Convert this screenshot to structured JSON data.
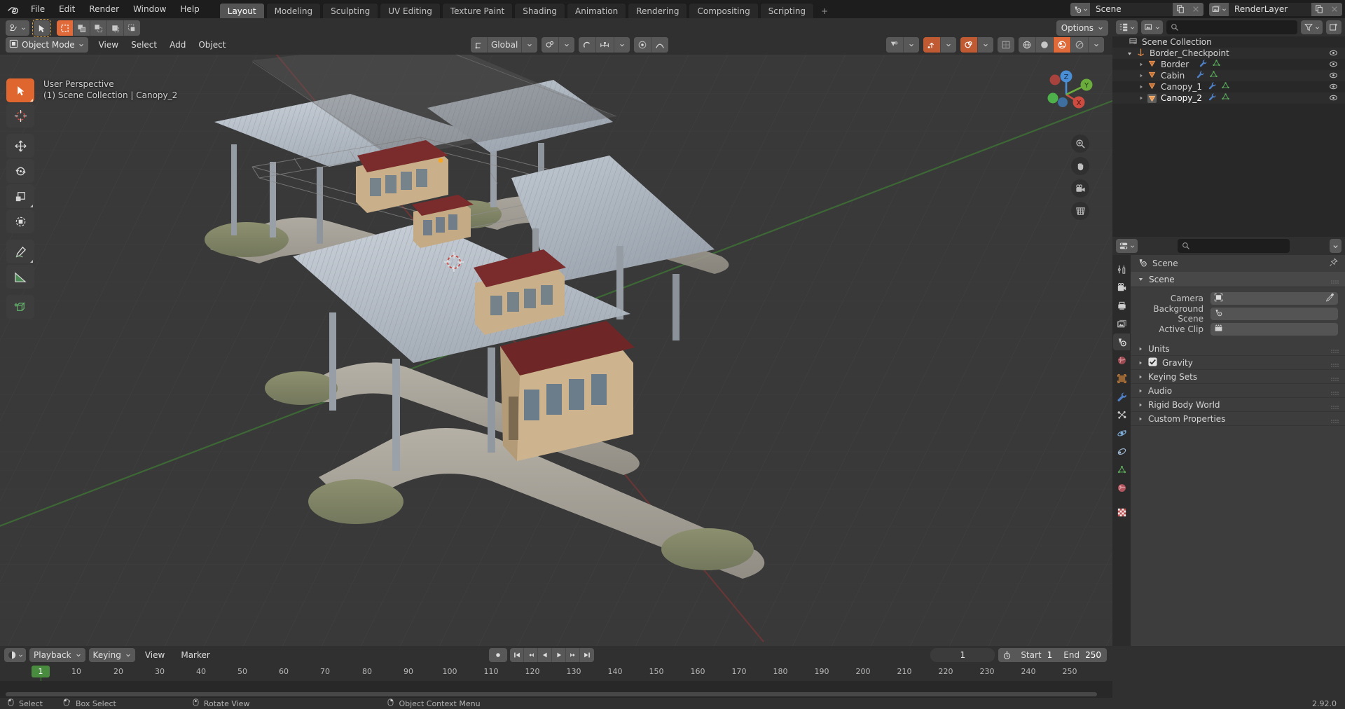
{
  "app": {
    "version": "2.92.0",
    "logo_icon": "blender-logo-icon"
  },
  "topbar": {
    "menus": [
      "File",
      "Edit",
      "Render",
      "Window",
      "Help"
    ],
    "workspaces": [
      {
        "label": "Layout",
        "active": true
      },
      {
        "label": "Modeling",
        "active": false
      },
      {
        "label": "Sculpting",
        "active": false
      },
      {
        "label": "UV Editing",
        "active": false
      },
      {
        "label": "Texture Paint",
        "active": false
      },
      {
        "label": "Shading",
        "active": false
      },
      {
        "label": "Animation",
        "active": false
      },
      {
        "label": "Rendering",
        "active": false
      },
      {
        "label": "Compositing",
        "active": false
      },
      {
        "label": "Scripting",
        "active": false
      }
    ],
    "add_workspace_label": "+",
    "scene": {
      "icon": "scene-icon",
      "value": "Scene",
      "new_icon": "duplicate-icon",
      "unlink_icon": "x-icon"
    },
    "view_layer": {
      "icon": "view-layer-icon",
      "value": "RenderLayer",
      "new_icon": "duplicate-icon",
      "unlink_icon": "x-icon"
    }
  },
  "viewport": {
    "editor_type_icon": "editor-type-3dview-icon",
    "mode": "Object Mode",
    "mode_icon": "object-mode-icon",
    "menus": [
      "View",
      "Select",
      "Add",
      "Object"
    ],
    "select_modes": [
      "select-box-icon",
      "select-extend-icon",
      "select-subtract-icon",
      "select-invert-icon",
      "select-intersect-icon"
    ],
    "cursor_icon": "select-tweak-icon",
    "transform_orientation": {
      "label": "Global",
      "icon": "orientation-icon"
    },
    "snap_icon": "snap-magnet-icon",
    "proportional_icon": "proportional-edit-icon",
    "proportional_falloff_icon": "falloff-smooth-icon",
    "options_label": "Options",
    "overlay_toggles": [
      "visibility-icon",
      "gizmo-icon",
      "overlays-icon",
      "xray-icon"
    ],
    "shading_modes": [
      "wireframe-icon",
      "solid-icon",
      "material-preview-icon",
      "rendered-icon"
    ],
    "overlay_text_line1": "User Perspective",
    "overlay_text_line2": "(1) Scene Collection | Canopy_2",
    "tools": [
      {
        "name": "tweak-tool",
        "icon": "cursor-arrow-icon",
        "active": true
      },
      {
        "name": "cursor-tool",
        "icon": "3d-cursor-icon",
        "active": false
      },
      {
        "name": "move-tool",
        "icon": "move-arrows-icon",
        "active": false
      },
      {
        "name": "rotate-tool",
        "icon": "rotate-icon",
        "active": false
      },
      {
        "name": "scale-tool",
        "icon": "scale-icon",
        "active": false
      },
      {
        "name": "transform-tool",
        "icon": "transform-icon",
        "active": false
      },
      {
        "name": "annotate-tool",
        "icon": "pencil-icon",
        "active": false
      },
      {
        "name": "measure-tool",
        "icon": "ruler-icon",
        "active": false
      },
      {
        "name": "add-cube-tool",
        "icon": "add-cube-icon",
        "active": false
      }
    ],
    "gizmo_axes": [
      {
        "label": "X",
        "color": "#e05a52"
      },
      {
        "label": "Y",
        "color": "#7fc04a"
      },
      {
        "label": "Z",
        "color": "#4a8ed6"
      }
    ],
    "nav_buttons": [
      "zoom-icon",
      "pan-hand-icon",
      "camera-view-icon",
      "toggle-perspective-icon"
    ]
  },
  "outliner": {
    "display_mode_icon": "outliner-display-mode-icon",
    "filter_id_icon": "view-layer-icon",
    "search_placeholder": "",
    "filter_icon": "funnel-icon",
    "new_collection_icon": "new-collection-icon",
    "root": {
      "label": "Scene Collection",
      "icon": "scene-collection-icon"
    },
    "items": [
      {
        "label": "Border_Checkpoint",
        "icon": "empty-axes-icon",
        "indent": 1,
        "expanded": true,
        "extra_icons": [],
        "visible": true,
        "active": false
      },
      {
        "label": "Border",
        "icon": "mesh-icon",
        "indent": 2,
        "expanded": false,
        "extra_icons": [
          "modifier-wrench-icon",
          "mesh-data-icon"
        ],
        "visible": true,
        "active": false
      },
      {
        "label": "Cabin",
        "icon": "mesh-icon",
        "indent": 2,
        "expanded": false,
        "extra_icons": [
          "modifier-wrench-icon",
          "mesh-data-icon"
        ],
        "visible": true,
        "active": false
      },
      {
        "label": "Canopy_1",
        "icon": "mesh-icon",
        "indent": 2,
        "expanded": false,
        "extra_icons": [
          "modifier-wrench-icon",
          "mesh-data-icon"
        ],
        "visible": true,
        "active": false
      },
      {
        "label": "Canopy_2",
        "icon": "mesh-icon",
        "indent": 2,
        "expanded": false,
        "extra_icons": [
          "modifier-wrench-icon",
          "mesh-data-icon"
        ],
        "visible": true,
        "active": true
      }
    ]
  },
  "properties": {
    "editor_type_icon": "properties-editor-icon",
    "search_placeholder": "",
    "options_icon": "chevron-down-icon",
    "tabs": [
      {
        "name": "tool",
        "icon": "tool-icon",
        "active": false
      },
      {
        "name": "render",
        "icon": "render-camera-icon",
        "active": false
      },
      {
        "name": "output",
        "icon": "printer-icon",
        "active": false
      },
      {
        "name": "view-layer",
        "icon": "images-icon",
        "active": false
      },
      {
        "name": "scene",
        "icon": "scene-icon",
        "active": true
      },
      {
        "name": "world",
        "icon": "world-icon",
        "active": false
      },
      {
        "name": "object",
        "icon": "object-square-icon",
        "active": false
      },
      {
        "name": "modifiers",
        "icon": "wrench-icon",
        "active": false
      },
      {
        "name": "particles",
        "icon": "particles-icon",
        "active": false
      },
      {
        "name": "physics",
        "icon": "physics-orbit-icon",
        "active": false
      },
      {
        "name": "constraints",
        "icon": "constraint-icon",
        "active": false
      },
      {
        "name": "data",
        "icon": "mesh-data-icon",
        "active": false
      },
      {
        "name": "material",
        "icon": "material-sphere-icon",
        "active": false
      },
      {
        "name": "texture",
        "icon": "texture-checker-icon",
        "active": false
      }
    ],
    "breadcrumb": {
      "icon": "scene-icon",
      "label": "Scene",
      "pin_icon": "pin-icon"
    },
    "scene_panel": {
      "title": "Scene",
      "expanded": true,
      "fields": [
        {
          "label": "Camera",
          "icon": "camera-object-icon",
          "value": "",
          "eyedropper": true
        },
        {
          "label": "Background Scene",
          "icon": "scene-icon",
          "value": "",
          "eyedropper": false
        },
        {
          "label": "Active Clip",
          "icon": "clip-icon",
          "value": "",
          "eyedropper": false
        }
      ]
    },
    "closed_panels": [
      {
        "label": "Units",
        "checkbox": null
      },
      {
        "label": "Gravity",
        "checkbox": true
      },
      {
        "label": "Keying Sets",
        "checkbox": null
      },
      {
        "label": "Audio",
        "checkbox": null
      },
      {
        "label": "Rigid Body World",
        "checkbox": null
      },
      {
        "label": "Custom Properties",
        "checkbox": null
      }
    ]
  },
  "timeline": {
    "editor_type_icon": "timeline-editor-icon",
    "menus": [
      {
        "label": "Playback",
        "dropdown": true
      },
      {
        "label": "Keying",
        "dropdown": true
      },
      {
        "label": "View",
        "dropdown": false
      },
      {
        "label": "Marker",
        "dropdown": false
      }
    ],
    "record_icon": "auto-keying-record-icon",
    "playback_buttons": [
      "jump-start-icon",
      "prev-keyframe-icon",
      "play-reverse-icon",
      "play-icon",
      "next-keyframe-icon",
      "jump-end-icon"
    ],
    "current_frame": "1",
    "use_preview_range_icon": "stopwatch-icon",
    "start_label": "Start",
    "start_value": "1",
    "end_label": "End",
    "end_value": "250",
    "ruler_ticks": [
      10,
      20,
      30,
      40,
      50,
      60,
      70,
      80,
      90,
      100,
      110,
      120,
      130,
      140,
      150,
      160,
      170,
      180,
      190,
      200,
      210,
      220,
      230,
      240,
      250
    ],
    "playhead_frame": "1"
  },
  "statusbar": {
    "items": [
      {
        "icon": "mouse-left-icon",
        "label": "Select"
      },
      {
        "icon": "mouse-left-drag-icon",
        "label": "Box Select"
      },
      {
        "icon": "mouse-middle-icon",
        "label": "Rotate View"
      },
      {
        "icon": "mouse-right-icon",
        "label": "Object Context Menu"
      }
    ],
    "version": "2.92.0"
  },
  "colors": {
    "accent_orange": "#e0662f",
    "accent_blue": "#4772b3",
    "select_green": "#4a8c3f",
    "header_bg": "#303030",
    "panel_bg": "#3d3d3d",
    "viewport_bg": "#393939",
    "axis_x": "#e05a52",
    "axis_y": "#7fc04a",
    "axis_z": "#4a8ed6"
  }
}
